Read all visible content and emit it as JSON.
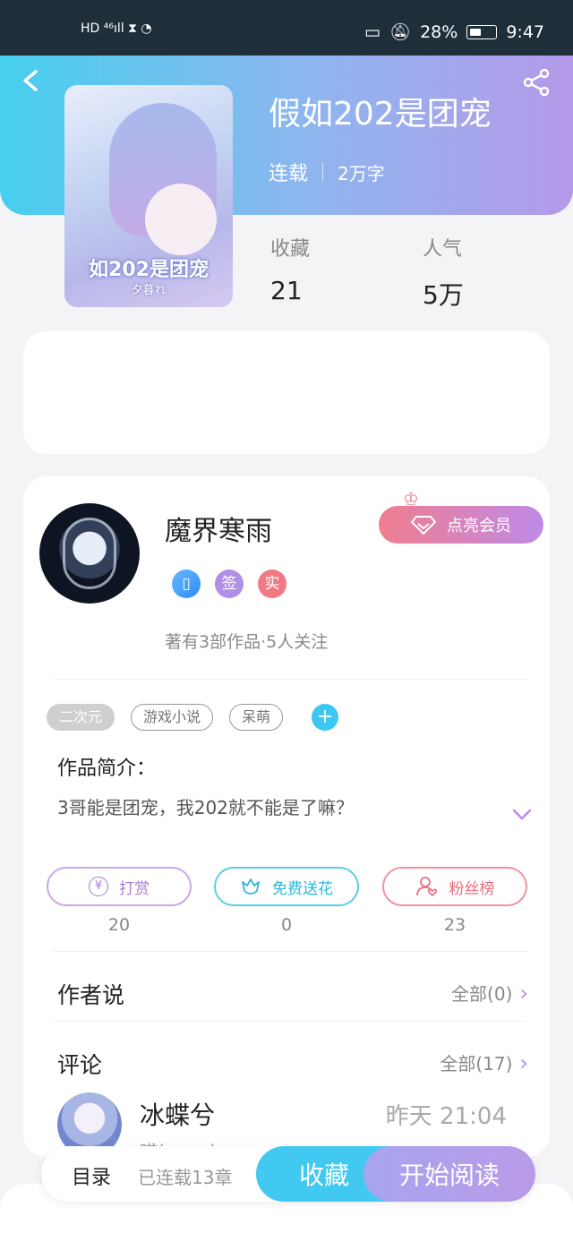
{
  "status_bar": {
    "left_indicators": "HD ⁴⁶ıll ⧗ ◔",
    "battery_percent": "28%",
    "time": "9:47",
    "battery_level": 0.28
  },
  "header": {
    "back_icon": "back-chevron-icon",
    "share_icon": "share-icon"
  },
  "book": {
    "cover_title": "如202是团宠",
    "cover_author": "夕暮れ",
    "title": "假如202是团宠",
    "status": "连载",
    "word_count": "2万字",
    "stats": [
      {
        "label": "收藏",
        "value": "21"
      },
      {
        "label": "人气",
        "value": "5万"
      }
    ]
  },
  "author": {
    "name": "魔界寒雨",
    "badges": [
      "▯",
      "签",
      "实"
    ],
    "summary": "著有3部作品·5人关注",
    "vip_label": "点亮会员"
  },
  "tags": [
    "二次元",
    "游戏小说",
    "呆萌"
  ],
  "intro": {
    "title": "作品简介：",
    "text": "3哥能是团宠，我202就不能是了嘛？"
  },
  "actions": [
    {
      "label": "打赏",
      "count": "20"
    },
    {
      "label": "免费送花",
      "count": "0"
    },
    {
      "label": "粉丝榜",
      "count": "23"
    }
  ],
  "author_says": {
    "title": "作者说",
    "more": "全部(0)"
  },
  "comments": {
    "title": "评论",
    "more": "全部(17)",
    "first": {
      "name": "冰蝶兮",
      "time": "昨天 21:04",
      "preview": "喵(~ω~)"
    }
  },
  "bottom_bar": {
    "catalog": "目录",
    "progress": "已连载13章",
    "favorite": "收藏",
    "start_reading": "开始阅读"
  },
  "colors": {
    "gradient_start": "#46cfee",
    "gradient_end": "#b49ae9",
    "accent_blue": "#41c9f1",
    "accent_purple": "#b99be8",
    "accent_red": "#ea6c78"
  }
}
